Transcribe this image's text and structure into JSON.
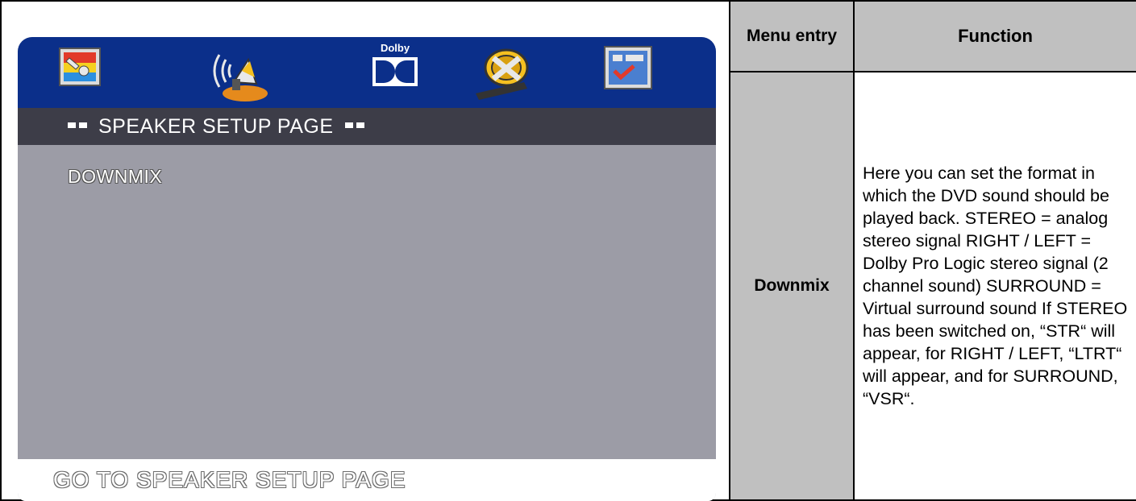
{
  "table": {
    "header_menu_entry": "Menu entry",
    "header_function": "Function",
    "row_entry": "Downmix",
    "row_function": "Here you can set the format in which the DVD sound should be played back. STEREO = analog stereo signal RIGHT / LEFT = Dolby Pro Logic stereo signal (2 channel sound) SURROUND = Virtual surround sound If STEREO has been switched on, “STR“ will appear, for RIGHT / LEFT, “LTRT“ will appear, and for SURROUND, “VSR“."
  },
  "osd": {
    "icons": [
      "general-setup-icon",
      "speaker-setup-icon",
      "dolby-setup-icon",
      "video-setup-icon",
      "preference-icon"
    ],
    "dolby_label": "Dolby",
    "page_title": "SPEAKER SETUP PAGE",
    "menu_item": "DOWNMIX",
    "footer": "GO TO SPEAKER  SETUP PAGE",
    "colors": {
      "icon_bar": "#0b2f8a",
      "title_bar": "#3d3d48",
      "body": "#9c9ca6",
      "footer": "#ffffff"
    }
  }
}
